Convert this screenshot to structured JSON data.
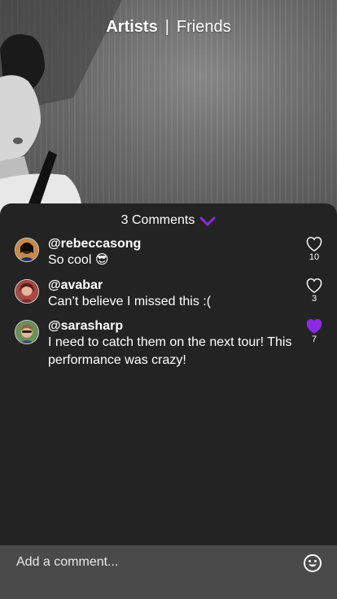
{
  "top_tabs": {
    "active": "Artists",
    "separator": "|",
    "inactive": "Friends"
  },
  "comments": {
    "header": "3 Comments",
    "accent_color": "#8b2be2",
    "items": [
      {
        "username": "@rebeccasong",
        "text": "So cool 😎",
        "likes": "10",
        "liked": false
      },
      {
        "username": "@avabar",
        "text": "Can’t believe I missed this :(",
        "likes": "3",
        "liked": false
      },
      {
        "username": "@sarasharp",
        "text": "I need to catch them on the next tour! This performance was crazy!",
        "likes": "7",
        "liked": true
      }
    ]
  },
  "composer": {
    "placeholder": "Add a comment...",
    "emoji_icon": "smiley-icon"
  },
  "icons": {
    "chevron": "chevron-down-icon",
    "like": "heart-icon"
  }
}
